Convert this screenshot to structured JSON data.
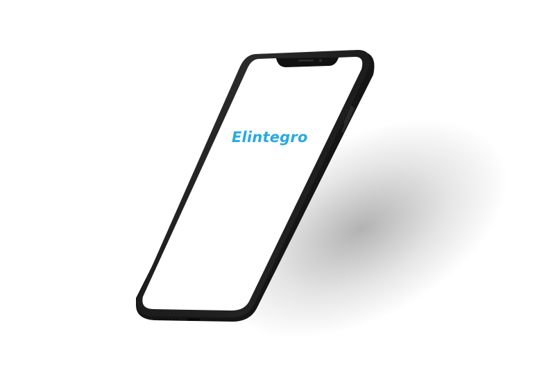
{
  "app": {
    "brand_text": "Elintegro",
    "brand_color": "#27aae1"
  },
  "device": {
    "type": "smartphone-mockup",
    "screen_color": "#ffffff",
    "frame_color": "#1e1e1e"
  }
}
